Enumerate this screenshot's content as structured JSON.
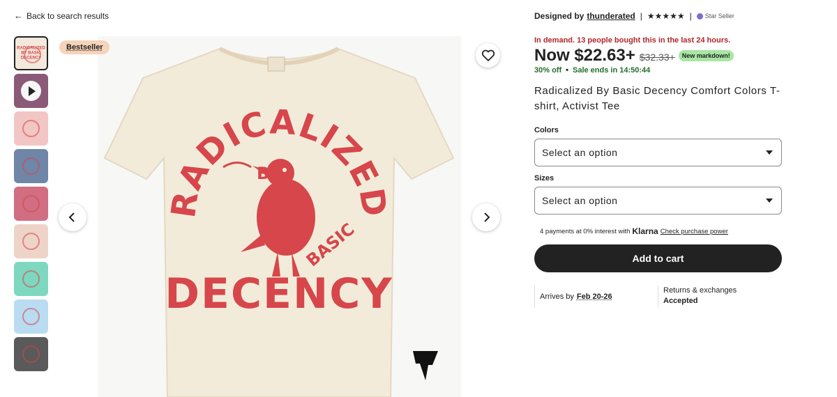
{
  "back_link": {
    "label": "Back to search results",
    "icon": "arrow-left-icon"
  },
  "badge": {
    "label": "Bestseller"
  },
  "thumbnails": [
    {
      "kind": "image",
      "mini_text": "RADICALIZED BY BASIC DECENCY",
      "bg": "#f3e8dc"
    },
    {
      "kind": "video",
      "mini_text": "",
      "bg": "#8b5a78"
    },
    {
      "kind": "image",
      "mini_text": "",
      "bg": "#f2c6c4"
    },
    {
      "kind": "image",
      "mini_text": "",
      "bg": "#6f86a8"
    },
    {
      "kind": "image",
      "mini_text": "",
      "bg": "#d16e82"
    },
    {
      "kind": "image",
      "mini_text": "",
      "bg": "#eed4c8"
    },
    {
      "kind": "image",
      "mini_text": "",
      "bg": "#7ed8c0"
    },
    {
      "kind": "image",
      "mini_text": "",
      "bg": "#b9dcf2"
    },
    {
      "kind": "image",
      "mini_text": "",
      "bg": "#5a5a5a"
    }
  ],
  "product_image": {
    "shirt_color": "#f3ebd9",
    "print_color": "#d6464b",
    "arc_top": "RADICALIZED",
    "by": "BY",
    "basic": "BASIC",
    "bottom": "DECENCY"
  },
  "designed_by": {
    "prefix": "Designed by",
    "shop": "thunderated",
    "rating_stars": "★★★★★",
    "star_seller": "Star Seller"
  },
  "demand_text": "In demand. 13 people bought this in the last 24 hours.",
  "price": {
    "now": "Now $22.63+",
    "old": "$32.33+",
    "markdown": "New markdown!"
  },
  "sale": {
    "discount": "30% off",
    "ends": "Sale ends in 14:50:44"
  },
  "title": "Radicalized By Basic Decency Comfort Colors T-shirt, Activist Tee",
  "colors": {
    "label": "Colors",
    "placeholder": "Select an option"
  },
  "sizes": {
    "label": "Sizes",
    "placeholder": "Select an option"
  },
  "payments": {
    "text": "4 payments at 0% interest with",
    "brand": "Klarna",
    "link": "Check purchase power"
  },
  "cart_button": "Add to cart",
  "arrives": {
    "prefix": "Arrives by",
    "dates": "Feb 20-26"
  },
  "returns": {
    "line1": "Returns & exchanges",
    "line2": "Accepted"
  }
}
